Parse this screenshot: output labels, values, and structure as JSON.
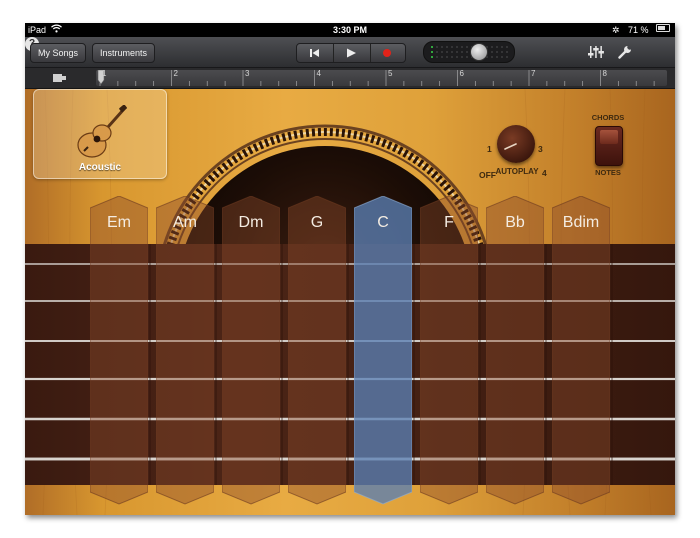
{
  "status_bar": {
    "device": "iPad",
    "time": "3:30 PM",
    "battery_text": "71 %",
    "battery_level": 0.71
  },
  "toolbar": {
    "my_songs_label": "My Songs",
    "instruments_label": "Instruments",
    "volume_level": 0.6
  },
  "ruler": {
    "ticks": [
      "1",
      "2",
      "3",
      "4",
      "5",
      "6",
      "7",
      "8"
    ]
  },
  "instrument": {
    "name": "Acoustic"
  },
  "autoplay": {
    "label": "AUTOPLAY",
    "off_label": "OFF",
    "positions": [
      "1",
      "2",
      "3",
      "4"
    ],
    "selected": "OFF"
  },
  "mode_switch": {
    "top_label": "CHORDS",
    "bottom_label": "NOTES",
    "selected": "CHORDS"
  },
  "chords": [
    {
      "label": "Em",
      "active": false
    },
    {
      "label": "Am",
      "active": false
    },
    {
      "label": "Dm",
      "active": false
    },
    {
      "label": "G",
      "active": false
    },
    {
      "label": "C",
      "active": true
    },
    {
      "label": "F",
      "active": false
    },
    {
      "label": "Bb",
      "active": false
    },
    {
      "label": "Bdim",
      "active": false
    }
  ],
  "colors": {
    "record": "#e2231a",
    "active_chord": "#5a7fb4",
    "wood": "#e2a23c",
    "fretboard": "#4b2416",
    "level_led": "#3ad44a"
  }
}
